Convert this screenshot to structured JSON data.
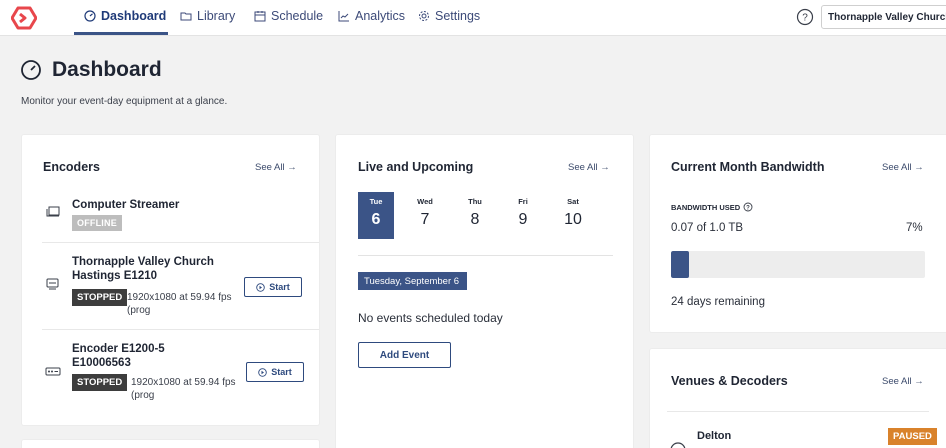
{
  "nav": {
    "items": [
      {
        "label": "Dashboard",
        "icon": "gauge-icon",
        "active": true
      },
      {
        "label": "Library",
        "icon": "folder-icon"
      },
      {
        "label": "Schedule",
        "icon": "calendar-icon"
      },
      {
        "label": "Analytics",
        "icon": "chart-line-icon"
      },
      {
        "label": "Settings",
        "icon": "gear-icon"
      }
    ],
    "org": "Thornapple Valley Church",
    "accent": "#3b5487",
    "brand": "#e8474c"
  },
  "page": {
    "title": "Dashboard",
    "subtitle": "Monitor your event-day equipment at a glance."
  },
  "encoders": {
    "title": "Encoders",
    "see_all": "See All →",
    "items": [
      {
        "name": "Computer Streamer",
        "status": "OFFLINE",
        "icon": "laptop-icon"
      },
      {
        "name": "Thornapple Valley Church Hastings E1210",
        "status": "STOPPED",
        "resolution": "1920x1080 at 59.94 fps (prog",
        "action": "Start",
        "icon": "encoder-icon"
      },
      {
        "name": "Encoder E1200-5 E10006563",
        "status": "STOPPED",
        "resolution": "1920x1080 at 59.94 fps (prog",
        "action": "Start",
        "icon": "hardware-encoder-icon"
      }
    ]
  },
  "live": {
    "title": "Live and Upcoming",
    "see_all": "See All →",
    "days": [
      {
        "name": "Tue",
        "num": "6",
        "selected": true
      },
      {
        "name": "Wed",
        "num": "7"
      },
      {
        "name": "Thu",
        "num": "8"
      },
      {
        "name": "Fri",
        "num": "9"
      },
      {
        "name": "Sat",
        "num": "10"
      }
    ],
    "selected_date": "Tuesday, September 6",
    "empty": "No events scheduled today",
    "add_event": "Add Event"
  },
  "bandwidth": {
    "title": "Current Month Bandwidth",
    "see_all": "See All →",
    "label": "BANDWIDTH USED",
    "used": "0.07 of 1.0 TB",
    "percent_label": "7%",
    "percent": 7,
    "remaining": "24 days remaining"
  },
  "venues": {
    "title": "Venues & Decoders",
    "see_all": "See All →",
    "items": [
      {
        "name": "Delton",
        "status": "PAUSED"
      }
    ]
  }
}
